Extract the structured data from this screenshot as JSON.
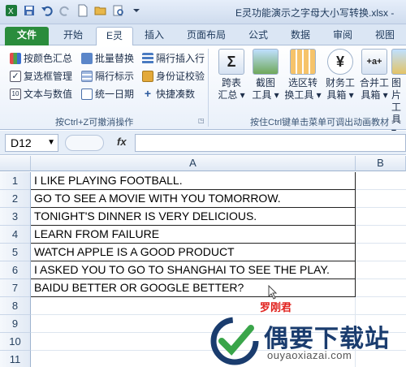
{
  "window": {
    "title": "E灵功能演示之字母大小写转换.xlsx -"
  },
  "tabs": [
    {
      "label": "文件"
    },
    {
      "label": "开始"
    },
    {
      "label": "E灵"
    },
    {
      "label": "插入"
    },
    {
      "label": "页面布局"
    },
    {
      "label": "公式"
    },
    {
      "label": "数据"
    },
    {
      "label": "审阅"
    },
    {
      "label": "视图"
    }
  ],
  "ribbon": {
    "small": [
      "按颜色汇总",
      "批量替换",
      "隔行插入行",
      "复选框管理",
      "隔行标示",
      "身份证校验",
      "文本与数值",
      "统一日期",
      "快捷凑数"
    ],
    "group1_caption": "按Ctrl+Z可撤消操作",
    "big": [
      {
        "l1": "跨表",
        "l2": "汇总 ▾"
      },
      {
        "l1": "截图",
        "l2": "工具 ▾"
      },
      {
        "l1": "选区转",
        "l2": "换工具 ▾"
      },
      {
        "l1": "财务工",
        "l2": "具箱 ▾"
      },
      {
        "l1": "合并工",
        "l2": "具箱 ▾"
      },
      {
        "l1": "图片",
        "l2": "工具 ▾"
      }
    ],
    "group2_caption": "按住Ctrl键单击菜单可调出动画教材",
    "big_icon_glyphs": [
      "Σ",
      "",
      "",
      "¥",
      "+a+",
      ""
    ]
  },
  "formula_bar": {
    "name_box": "D12",
    "fx": "fx",
    "formula": ""
  },
  "sheet": {
    "columns": [
      "A",
      "B"
    ],
    "rows": [
      "1",
      "2",
      "3",
      "4",
      "5",
      "6",
      "7",
      "8",
      "9",
      "10",
      "11"
    ],
    "cells": [
      "I LIKE PLAYING FOOTBALL.",
      "GO TO SEE A MOVIE WITH YOU TOMORROW.",
      "TONIGHT'S DINNER IS VERY DELICIOUS.",
      "LEARN FROM FAILURE",
      "WATCH APPLE IS A GOOD PRODUCT",
      "I ASKED YOU TO GO TO SHANGHAI TO SEE THE PLAY.",
      "BAIDU BETTER OR GOOGLE BETTER?"
    ]
  },
  "signature": "罗刚君",
  "watermark": {
    "brand": "偶要下载站",
    "url": "ouyaoxiazai.com"
  },
  "colors": {
    "file_tab": "#2a8c3c",
    "signature": "#e0201c",
    "brand": "#1a3c6e"
  }
}
